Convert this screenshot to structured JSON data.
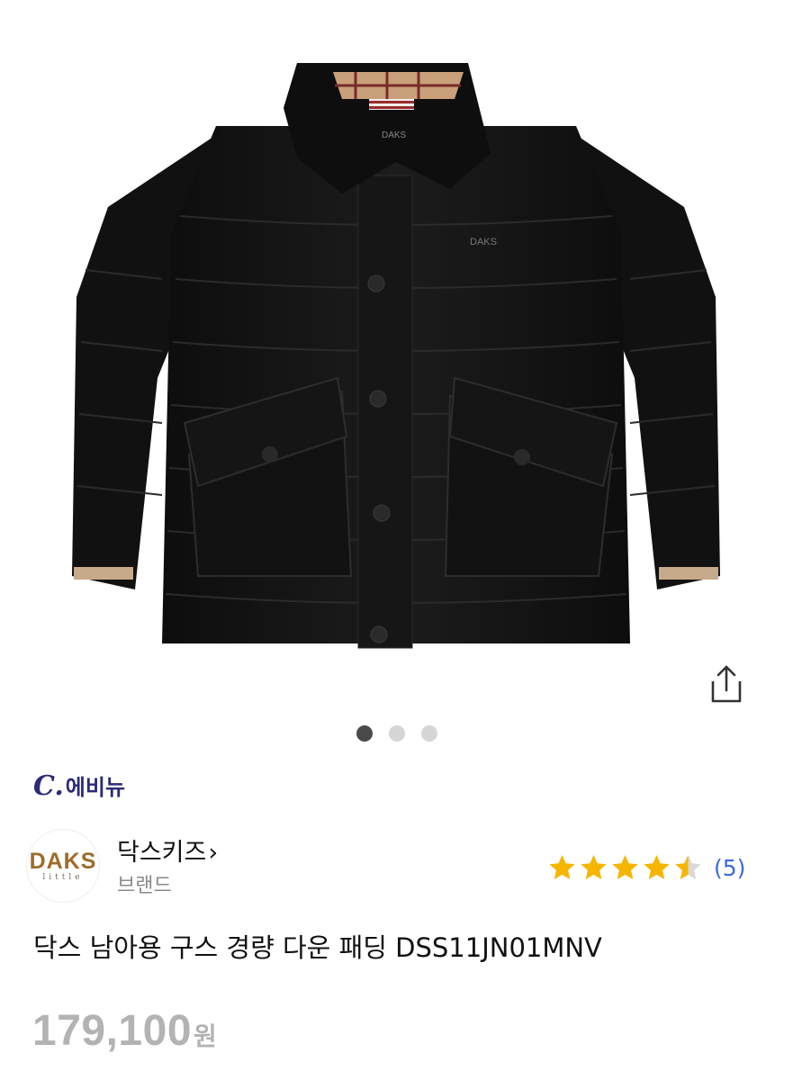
{
  "product_image": {
    "alt": "product-photo",
    "logo_text": "DAKS"
  },
  "gallery": {
    "total_slides": 3,
    "active_index": 0
  },
  "badge": {
    "c": "C.",
    "text": "에비뉴"
  },
  "brand": {
    "logo_main": "DAKS",
    "logo_sub": "little",
    "name": "닥스키즈",
    "chevron": "›",
    "subtitle": "브랜드"
  },
  "rating": {
    "value": 4.5,
    "max": 5,
    "count_label": "(5)",
    "star_color": "#f6b500",
    "empty_color": "#d9d9d9"
  },
  "product": {
    "title": "닥스 남아용 구스 경량 다운 패딩 DSS11JN01MNV",
    "price": "179,100",
    "currency": "원"
  },
  "icons": {
    "share": "share-icon"
  }
}
